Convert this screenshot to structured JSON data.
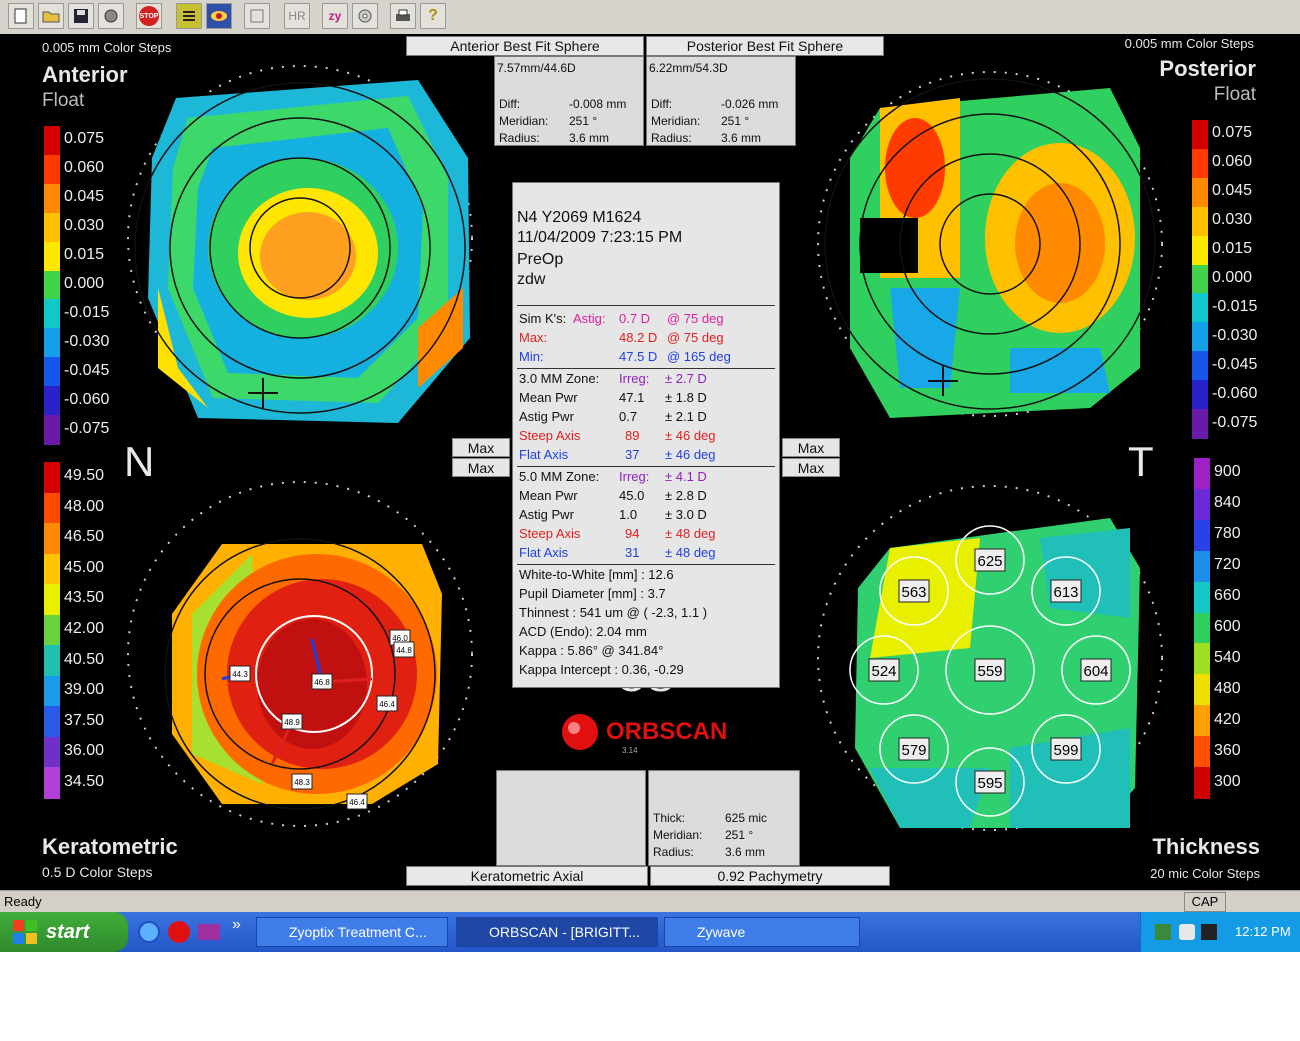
{
  "toolbar": {
    "buttons": [
      "new-doc-icon",
      "open-folder-icon",
      "save-disk-icon",
      "print-setup-icon",
      "stop-icon",
      "list-icon",
      "eye-icon",
      "panel-icon",
      "hr-label",
      "zy-label",
      "cd-icon",
      "printer-icon",
      "help-icon"
    ],
    "stop_label": "STOP",
    "hr_label": "HR",
    "zy_label": "zy",
    "help_label": "?"
  },
  "anterior": {
    "steps": "0.005 mm Color Steps",
    "title": "Anterior",
    "subtitle": "Float",
    "scale": [
      "0.075",
      "0.060",
      "0.045",
      "0.030",
      "0.015",
      "0.000",
      "-0.015",
      "-0.030",
      "-0.045",
      "-0.060",
      "-0.075"
    ]
  },
  "posterior": {
    "steps": "0.005 mm Color Steps",
    "title": "Posterior",
    "subtitle": "Float",
    "scale": [
      "0.075",
      "0.060",
      "0.045",
      "0.030",
      "0.015",
      "0.000",
      "-0.015",
      "-0.030",
      "-0.045",
      "-0.060",
      "-0.075"
    ]
  },
  "keratometric": {
    "title": "Keratometric",
    "steps": "0.5 D Color Steps",
    "scale": [
      "49.50",
      "48.00",
      "46.50",
      "45.00",
      "43.50",
      "42.00",
      "40.50",
      "39.00",
      "37.50",
      "36.00",
      "34.50"
    ],
    "labels": [
      "44.3",
      "46.8",
      "48.9",
      "46.4",
      "46.0",
      "44.8",
      "48.3",
      "46.4"
    ]
  },
  "thickness": {
    "title": "Thickness",
    "steps": "20 mic Color Steps",
    "scale": [
      "900",
      "840",
      "780",
      "720",
      "660",
      "600",
      "540",
      "480",
      "420",
      "360",
      "300"
    ],
    "values": [
      "625",
      "563",
      "613",
      "524",
      "559",
      "604",
      "579",
      "599",
      "595"
    ]
  },
  "headers": {
    "anterior_bfs": "Anterior Best Fit Sphere",
    "posterior_bfs": "Posterior Best Fit Sphere",
    "keratometric_axial": "Keratometric Axial",
    "pachymetry": "0.92 Pachymetry"
  },
  "anterior_box": {
    "sphere": "7.57mm/44.6D",
    "diff_label": "Diff:",
    "diff": "-0.008 mm",
    "meridian_label": "Meridian:",
    "meridian": "251 °",
    "radius_label": "Radius:",
    "radius": "3.6 mm"
  },
  "posterior_box": {
    "sphere": "6.22mm/54.3D",
    "diff_label": "Diff:",
    "diff": "-0.026 mm",
    "meridian_label": "Meridian:",
    "meridian": "251 °",
    "radius_label": "Radius:",
    "radius": "3.6 mm"
  },
  "bottom_box": {
    "thick_label": "Thick:",
    "thick": "625 mic",
    "meridian_label": "Meridian:",
    "meridian": "251 °",
    "radius_label": "Radius:",
    "radius": "3.6 mm"
  },
  "center": {
    "id": "N4 Y2069 M1624",
    "datetime": "11/04/2009 7:23:15 PM",
    "status": "PreOp",
    "operator": "zdw",
    "simk_label": "Sim K's:",
    "astig_label": "Astig:",
    "astig_val": "0.7 D",
    "astig_deg": "@ 75 deg",
    "max_label": "Max:",
    "max_val": "48.2 D",
    "max_deg": "@ 75 deg",
    "min_label": "Min:",
    "min_val": "47.5 D",
    "min_deg": "@ 165 deg",
    "z3_label": "3.0 MM Zone:",
    "z3_irreg_label": "Irreg:",
    "z3_irreg": "± 2.7 D",
    "z3_mean_label": "Mean Pwr",
    "z3_mean": "47.1",
    "z3_mean_pm": "± 1.8 D",
    "z3_astig_label": "Astig Pwr",
    "z3_astig": "0.7",
    "z3_astig_pm": "± 2.1 D",
    "z3_steep_label": "Steep Axis",
    "z3_steep": "89",
    "z3_steep_pm": "± 46 deg",
    "z3_flat_label": "Flat Axis",
    "z3_flat": "37",
    "z3_flat_pm": "± 46 deg",
    "z5_label": "5.0 MM Zone:",
    "z5_irreg_label": "Irreg:",
    "z5_irreg": "± 4.1 D",
    "z5_mean_label": "Mean Pwr",
    "z5_mean": "45.0",
    "z5_mean_pm": "± 2.8 D",
    "z5_astig_label": "Astig Pwr",
    "z5_astig": "1.0",
    "z5_astig_pm": "± 3.0 D",
    "z5_steep_label": "Steep Axis",
    "z5_steep": "94",
    "z5_steep_pm": "± 48 deg",
    "z5_flat_label": "Flat Axis",
    "z5_flat": "31",
    "z5_flat_pm": "± 48 deg",
    "wtw": "White-to-White [mm] : 12.6",
    "pupil": "Pupil Diameter [mm] : 3.7",
    "thinnest": "Thinnest : 541 um @ ( -2.3, 1.1 )",
    "acd": "ACD (Endo): 2.04 mm",
    "kappa": "Kappa : 5.86° @ 341.84°",
    "kappa_int": "Kappa Intercept : 0.36, -0.29"
  },
  "side_labels": {
    "nasal": "N",
    "temporal": "T",
    "eye": "OS"
  },
  "max_buttons": [
    "Max",
    "Max",
    "Max",
    "Max"
  ],
  "logo": {
    "name": "ORBSCAN",
    "version": "3.14"
  },
  "status": {
    "ready": "Ready",
    "cap": "CAP"
  },
  "taskbar": {
    "start": "start",
    "tasks": [
      "Zyoptix Treatment C...",
      "ORBSCAN - [BRIGITT...",
      "Zywave"
    ],
    "clock": "12:12 PM",
    "chevron": "»"
  },
  "colors": {
    "scale_ant": [
      "#d40000",
      "#ff3b00",
      "#ff8a00",
      "#ffc000",
      "#ffe800",
      "#40d24a",
      "#10c8c8",
      "#12a0e8",
      "#1656e8",
      "#2a22c8",
      "#6a1aa8"
    ],
    "scale_ker": [
      "#d40000",
      "#ff4a00",
      "#ff8a00",
      "#ffc400",
      "#e8f000",
      "#6ad23a",
      "#20c0b0",
      "#1a9ae8",
      "#2a5ae8",
      "#7030c8",
      "#b040d8"
    ],
    "scale_thk": [
      "#a020c8",
      "#6a2ad8",
      "#2a40e8",
      "#1a90e8",
      "#14c8c8",
      "#30d060",
      "#a0e020",
      "#f0e000",
      "#ffa000",
      "#ff5000",
      "#d00000"
    ]
  }
}
